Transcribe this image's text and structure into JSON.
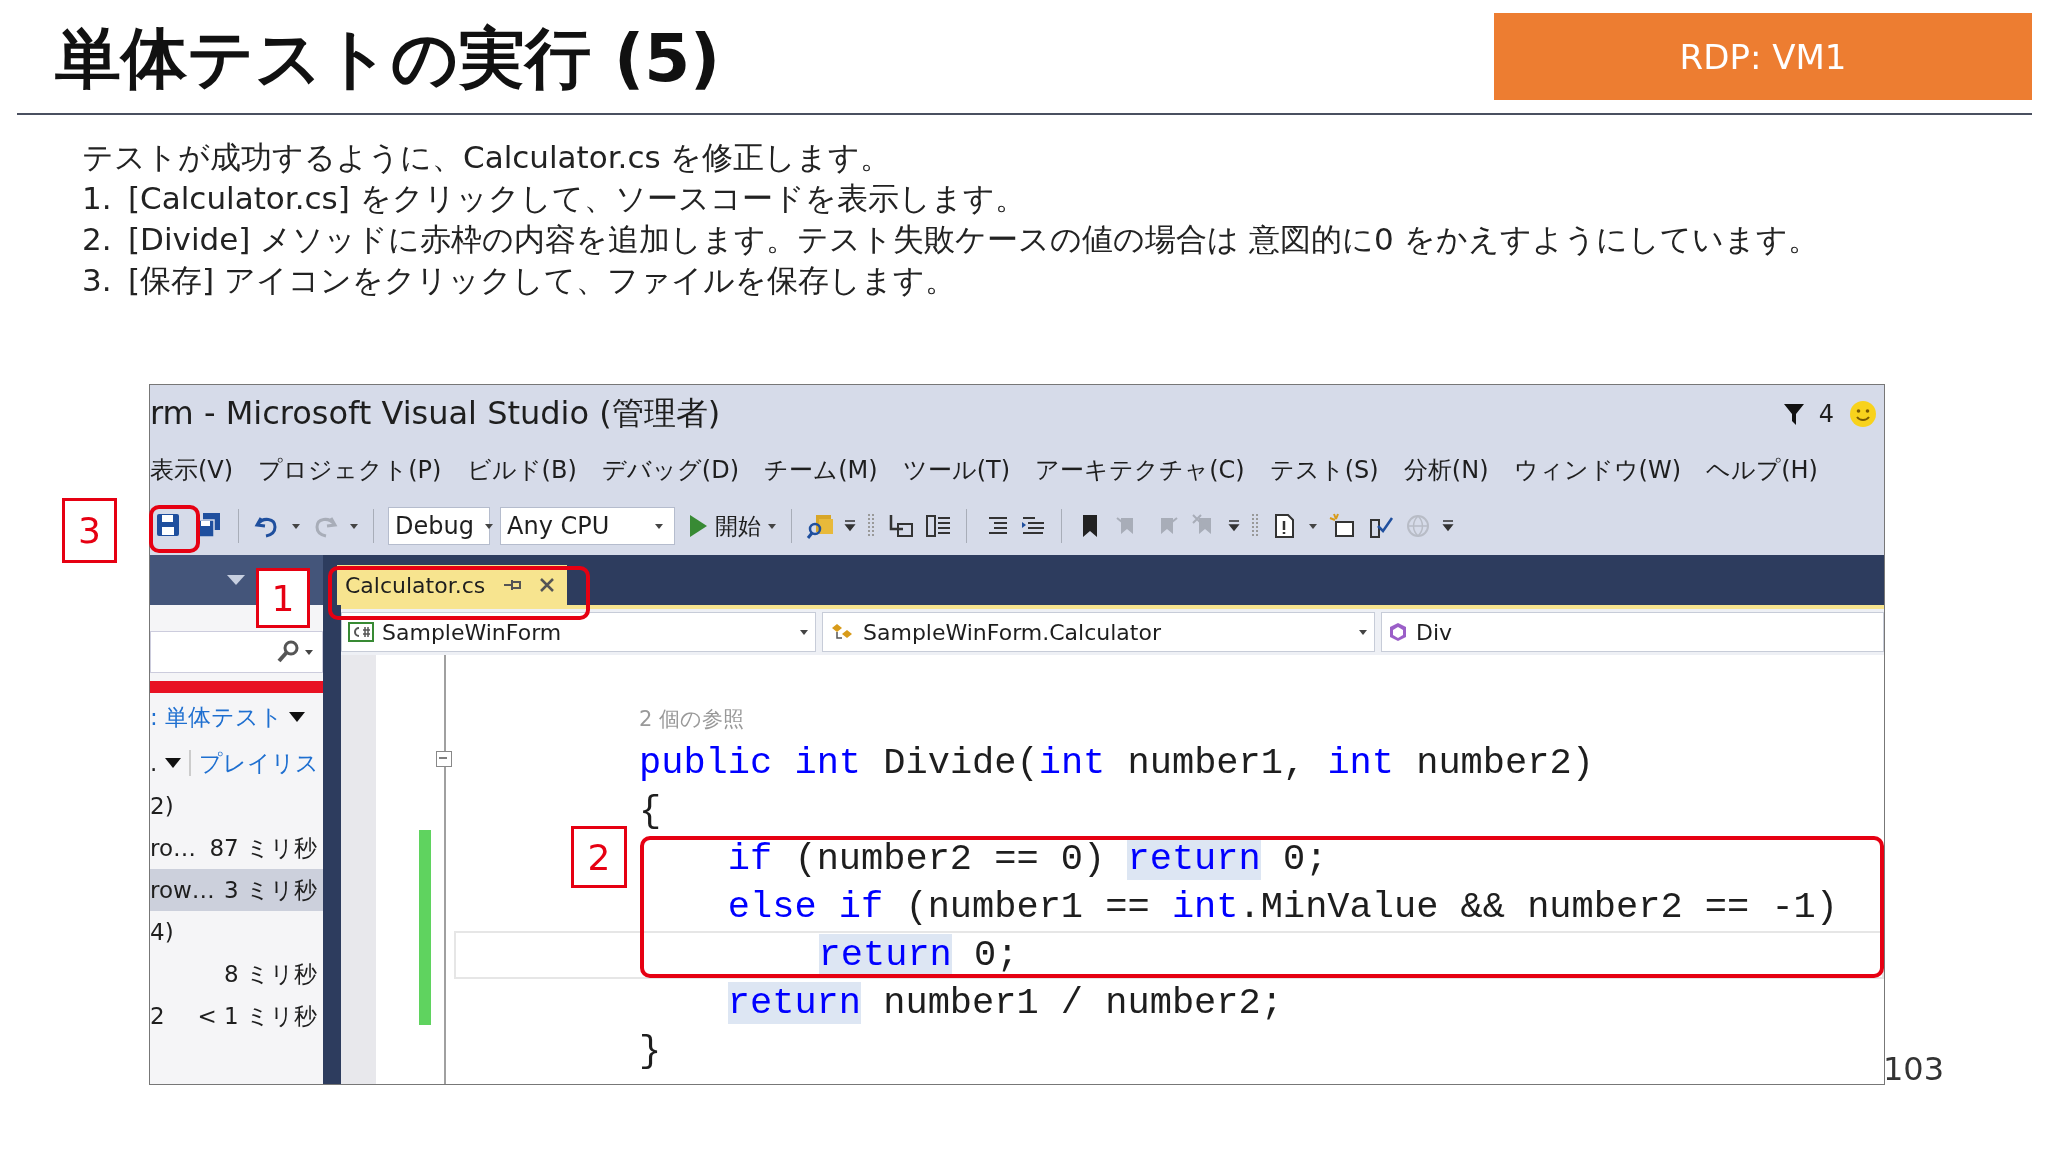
{
  "slide": {
    "title": "単体テストの実行 (5)",
    "badge": "RDP: VM1",
    "intro": "テストが成功するように、Calculator.cs を修正します。",
    "steps": [
      {
        "number": "1.",
        "text": "[Calculator.cs] をクリックして、ソースコードを表示します。"
      },
      {
        "number": "2.",
        "text": "[Divide] メソッドに赤枠の内容を追加します。テスト失敗ケースの値の場合は 意図的に0 をかえすようにしています。"
      },
      {
        "number": "3.",
        "text": "[保存] アイコンをクリックして、ファイルを保存します。"
      }
    ],
    "page_number": "103"
  },
  "window": {
    "title": "rm - Microsoft Visual Studio (管理者)",
    "notification_count": "4",
    "menu": [
      "表示(V)",
      "プロジェクト(P)",
      "ビルド(B)",
      "デバッグ(D)",
      "チーム(M)",
      "ツール(T)",
      "アーキテクチャ(C)",
      "テスト(S)",
      "分析(N)",
      "ウィンドウ(W)",
      "ヘルプ(H)"
    ],
    "toolbar": {
      "configuration": "Debug",
      "platform": "Any CPU",
      "start": "開始"
    },
    "tab": {
      "label": "Calculator.cs",
      "selected": true
    },
    "navbar": {
      "project": "SampleWinForm",
      "class": "SampleWinForm.Calculator",
      "member": "Div"
    },
    "test_panel": {
      "filter": ": 単体テスト",
      "group": ".",
      "playlist": "プレイリス",
      "rows": [
        {
          "name": "2)",
          "time": "",
          "selected": false
        },
        {
          "name": "ro…",
          "time": "87 ミリ秒",
          "selected": false
        },
        {
          "name": "row…",
          "time": "3 ミリ秒",
          "selected": true
        },
        {
          "name": "4)",
          "time": "",
          "selected": false
        },
        {
          "name": "",
          "time": "8 ミリ秒",
          "selected": false
        },
        {
          "name": "2",
          "time": "< 1 ミリ秒",
          "selected": false
        }
      ]
    },
    "code": {
      "codelens": "2 個の参照",
      "lines": [
        {
          "current": false,
          "tokens": [
            {
              "kind": "keyword",
              "text": "public "
            },
            {
              "kind": "keyword",
              "text": "int"
            },
            {
              "kind": "text",
              "text": " Divide("
            },
            {
              "kind": "keyword",
              "text": "int"
            },
            {
              "kind": "text",
              "text": " number1, "
            },
            {
              "kind": "keyword",
              "text": "int"
            },
            {
              "kind": "text",
              "text": " number2)"
            }
          ]
        },
        {
          "current": false,
          "tokens": [
            {
              "kind": "text",
              "text": "{"
            }
          ],
          "children": [
            {
              "current": false,
              "tokens": [
                {
                  "kind": "keyword",
                  "text": "if"
                },
                {
                  "kind": "text",
                  "text": " (number2 == 0) "
                },
                {
                  "kind": "marked_keyword",
                  "text": "return"
                },
                {
                  "kind": "text",
                  "text": " 0;"
                }
              ]
            },
            {
              "current": false,
              "tokens": [
                {
                  "kind": "keyword",
                  "text": "else if"
                },
                {
                  "kind": "text",
                  "text": " (number1 == "
                },
                {
                  "kind": "keyword",
                  "text": "int"
                },
                {
                  "kind": "text",
                  "text": ".MinValue && number2 == -1)"
                }
              ],
              "children": [
                {
                  "current": true,
                  "tokens": [
                    {
                      "kind": "marked_keyword",
                      "text": "return"
                    },
                    {
                      "kind": "text",
                      "text": " 0;"
                    }
                  ]
                }
              ]
            },
            {
              "current": false,
              "tokens": [
                {
                  "kind": "marked_keyword",
                  "text": "return"
                },
                {
                  "kind": "text",
                  "text": " number1 / number2;"
                }
              ]
            }
          ]
        },
        {
          "current": false,
          "tokens": [
            {
              "kind": "text",
              "text": "}"
            }
          ]
        }
      ]
    }
  },
  "callouts": [
    "3",
    "1",
    "2"
  ]
}
